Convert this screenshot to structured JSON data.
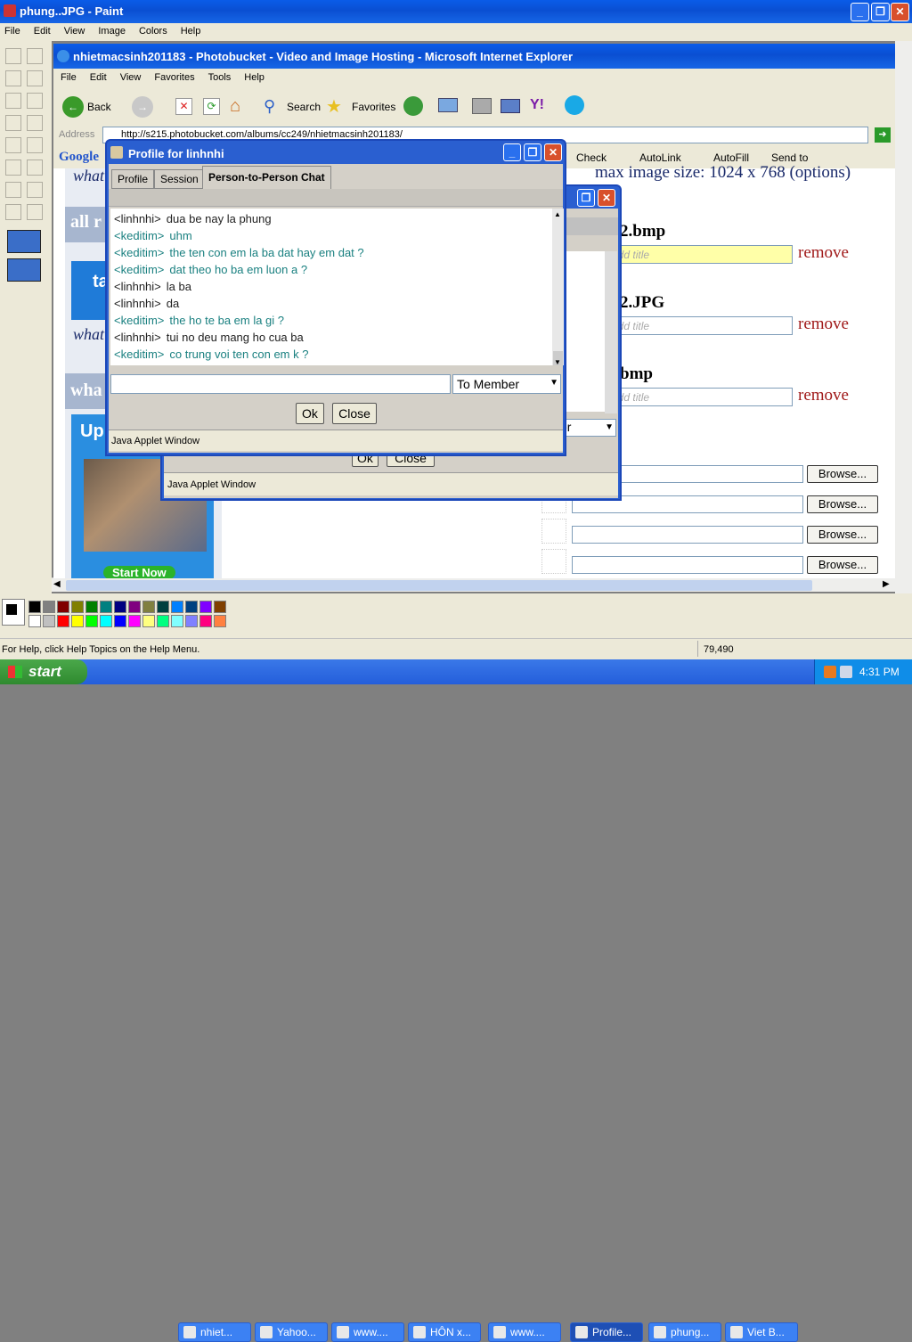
{
  "paint": {
    "title": "phung..JPG - Paint",
    "menu": [
      "File",
      "Edit",
      "View",
      "Image",
      "Colors",
      "Help"
    ],
    "status_help": "For Help, click Help Topics on the Help Menu.",
    "coords": "79,490"
  },
  "ie": {
    "title": "nhietmacsinh201183 - Photobucket - Video and Image Hosting - Microsoft Internet Explorer",
    "menu": [
      "File",
      "Edit",
      "View",
      "Favorites",
      "Tools",
      "Help"
    ],
    "back": "Back",
    "search": "Search",
    "favorites": "Favorites",
    "address_label": "Address",
    "url": "http://s215.photobucket.com/albums/cc249/nhietmacsinh201183/",
    "google": "Google",
    "gtools": [
      "Check",
      "AutoLink",
      "AutoFill",
      "Send to"
    ]
  },
  "page": {
    "max_size": "max image size: 1024 x 768 (options)",
    "files": [
      "2.bmp",
      "2.JPG",
      "bmp"
    ],
    "title_placeholder": "add title",
    "remove": "remove",
    "browse": "Browse...",
    "left_texts": [
      "what",
      "all r",
      "ta",
      "what",
      "wha",
      "Up",
      "Start Now"
    ]
  },
  "profile": {
    "title": "Profile for linhnhi",
    "tabs": [
      "Profile",
      "Session",
      "Person-to-Person Chat"
    ],
    "messages": [
      {
        "who": "<linhnhi>",
        "text": "dua be nay la phung",
        "color": "#222222"
      },
      {
        "who": "<keditim>",
        "text": "uhm",
        "color": "#1a8080"
      },
      {
        "who": "<keditim>",
        "text": "the ten con em la ba dat hay em dat ?",
        "color": "#1a8080"
      },
      {
        "who": "<keditim>",
        "text": "dat theo ho ba em luon a ?",
        "color": "#1a8080"
      },
      {
        "who": "<linhnhi>",
        "text": "la ba",
        "color": "#222222"
      },
      {
        "who": "<linhnhi>",
        "text": "da",
        "color": "#222222"
      },
      {
        "who": "<keditim>",
        "text": "the ho te ba em la gi ?",
        "color": "#1a8080"
      },
      {
        "who": "<linhnhi>",
        "text": "tui no deu mang ho cua ba",
        "color": "#222222"
      },
      {
        "who": "<keditim>",
        "text": "co trung voi ten con em k ?",
        "color": "#1a8080"
      }
    ],
    "to": "To Member",
    "ok": "Ok",
    "close": "Close",
    "java": "Java Applet Window"
  },
  "back_applet": {
    "ok": "Ok",
    "close": "Close",
    "java": "Java Applet Window",
    "select_tail": "er"
  },
  "taskbar": {
    "start": "start",
    "items": [
      "nhiet...",
      "Yahoo...",
      "www....",
      "HÔN x...",
      "www....",
      "Profile...",
      "phung...",
      "Viet B..."
    ],
    "time": "4:31 PM"
  }
}
